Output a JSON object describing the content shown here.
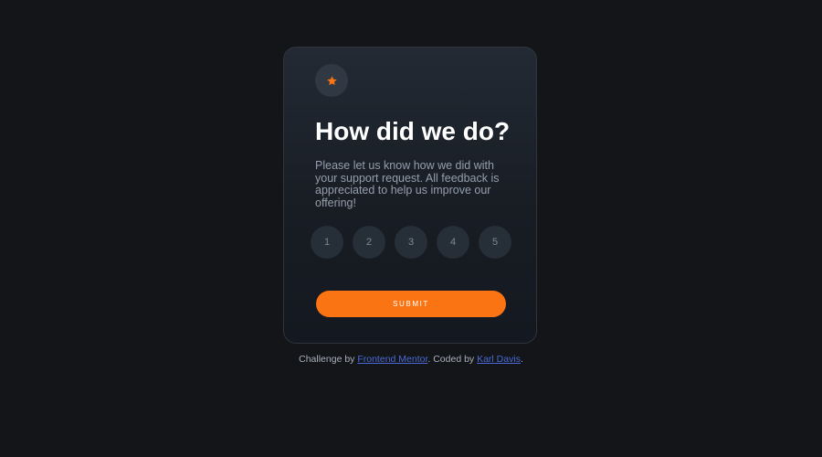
{
  "colors": {
    "background": "#131518",
    "card_top": "#232a34",
    "card_bottom": "#141820",
    "accent": "#fb7413",
    "rating_bg": "#262e38",
    "rating_text": "#7c8798",
    "body_text": "#959eac",
    "link": "#4a6ad6"
  },
  "card": {
    "icon": "star-icon",
    "title": "How did we do?",
    "description": "Please let us know how we did with your support request. All feedback is appreciated to help us improve our offering!",
    "ratings": [
      "1",
      "2",
      "3",
      "4",
      "5"
    ],
    "submit_label": "SUBMIT"
  },
  "attribution": {
    "prefix": "Challenge by ",
    "link1": "Frontend Mentor",
    "middle": ". Coded by ",
    "link2": "Karl Davis",
    "suffix": "."
  }
}
